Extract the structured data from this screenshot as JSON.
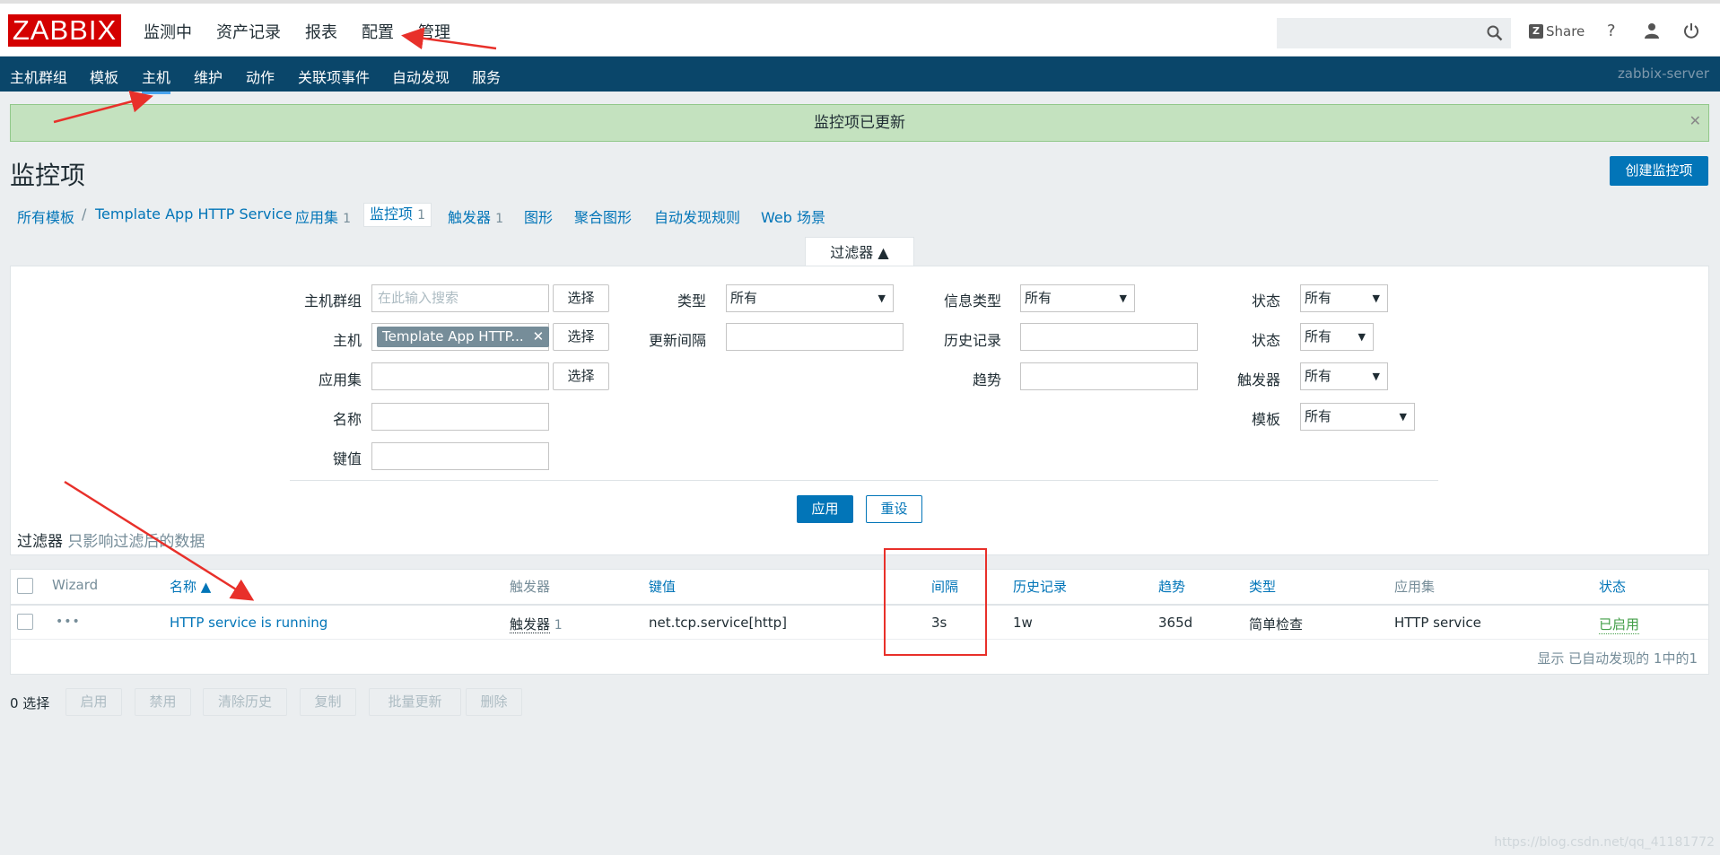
{
  "header": {
    "logo": "ZABBIX",
    "nav": [
      "监测中",
      "资产记录",
      "报表",
      "配置",
      "管理"
    ],
    "share": "Share",
    "help": "?"
  },
  "subnav": {
    "items": [
      "主机群组",
      "模板",
      "主机",
      "维护",
      "动作",
      "关联项事件",
      "自动发现",
      "服务"
    ],
    "active": "主机",
    "server": "zabbix-server"
  },
  "message": "监控项已更新",
  "page": {
    "title": "监控项",
    "create_button": "创建监控项"
  },
  "breadcrumbs": {
    "all_templates": "所有模板",
    "separator": "/",
    "template": "Template App HTTP Service",
    "applications": "应用集",
    "applications_count": "1",
    "items": "监控项",
    "items_count": "1",
    "triggers": "触发器",
    "triggers_count": "1",
    "graphs": "图形",
    "screens": "聚合图形",
    "discovery": "自动发现规则",
    "web": "Web 场景"
  },
  "filter": {
    "tab_label": "过滤器 ▲",
    "host_group_label": "主机群组",
    "host_group_placeholder": "在此输入搜索",
    "select_label": "选择",
    "host_label": "主机",
    "host_chip": "Template App HTTP...",
    "application_label": "应用集",
    "name_label": "名称",
    "key_label": "键值",
    "type_label": "类型",
    "type_value": "所有",
    "interval_label": "更新间隔",
    "info_type_label": "信息类型",
    "info_type_value": "所有",
    "history_label": "历史记录",
    "trends_label": "趋势",
    "state_label": "状态",
    "state_value": "所有",
    "status_label": "状态",
    "status_value": "所有",
    "triggers_label": "触发器",
    "triggers_value": "所有",
    "template_label": "模板",
    "template_value": "所有",
    "apply": "应用",
    "reset": "重设",
    "note_prefix": "过滤器",
    "note_text": "只影响过滤后的数据"
  },
  "table": {
    "headers": {
      "wizard": "Wizard",
      "name": "名称 ▲",
      "triggers": "触发器",
      "key": "键值",
      "interval": "间隔",
      "history": "历史记录",
      "trends": "趋势",
      "type": "类型",
      "applications": "应用集",
      "status": "状态"
    },
    "rows": [
      {
        "wizard": "•••",
        "name": "HTTP service is running",
        "triggers": "触发器",
        "triggers_count": "1",
        "key": "net.tcp.service[http]",
        "interval": "3s",
        "history": "1w",
        "trends": "365d",
        "type": "简单检查",
        "applications": "HTTP service",
        "status": "已启用"
      }
    ],
    "footer": "显示 已自动发现的 1中的1"
  },
  "actions": {
    "selected": "0 选择",
    "enable": "启用",
    "disable": "禁用",
    "clear_history": "清除历史",
    "copy": "复制",
    "mass_update": "批量更新",
    "delete": "删除"
  },
  "watermark": "https://blog.csdn.net/qq_41181772",
  "colors": {
    "brand": "#d40000",
    "subnav": "#0a466a",
    "link": "#0275b8",
    "success_bg": "#c4e2bf",
    "enabled": "#429e47",
    "annotation": "#e8302a"
  }
}
